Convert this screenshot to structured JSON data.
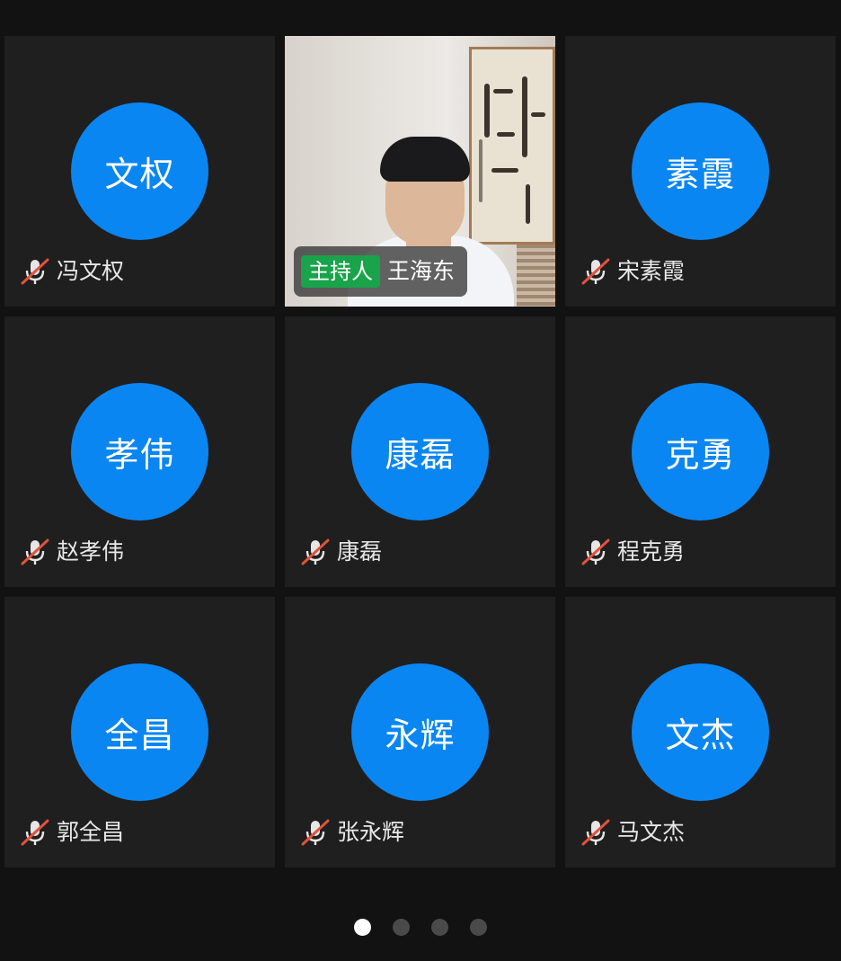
{
  "participants": [
    {
      "avatar": "文权",
      "name": "冯文权",
      "muted": true
    },
    {
      "host_badge": "主持人",
      "name": "王海东",
      "video": true
    },
    {
      "avatar": "素霞",
      "name": "宋素霞",
      "muted": true
    },
    {
      "avatar": "孝伟",
      "name": "赵孝伟",
      "muted": true
    },
    {
      "avatar": "康磊",
      "name": "康磊",
      "muted": true
    },
    {
      "avatar": "克勇",
      "name": "程克勇",
      "muted": true
    },
    {
      "avatar": "全昌",
      "name": "郭全昌",
      "muted": true
    },
    {
      "avatar": "永辉",
      "name": "张永辉",
      "muted": true
    },
    {
      "avatar": "文杰",
      "name": "马文杰",
      "muted": true
    }
  ],
  "pager": {
    "pages": 4,
    "current": 1
  },
  "colors": {
    "background": "#121212",
    "tile": "#1f1f1f",
    "avatar": "#0a86f2",
    "host_badge": "#19a34a",
    "mute_slash": "#e2523b"
  },
  "icons": {
    "muted": "mic-off-icon"
  }
}
